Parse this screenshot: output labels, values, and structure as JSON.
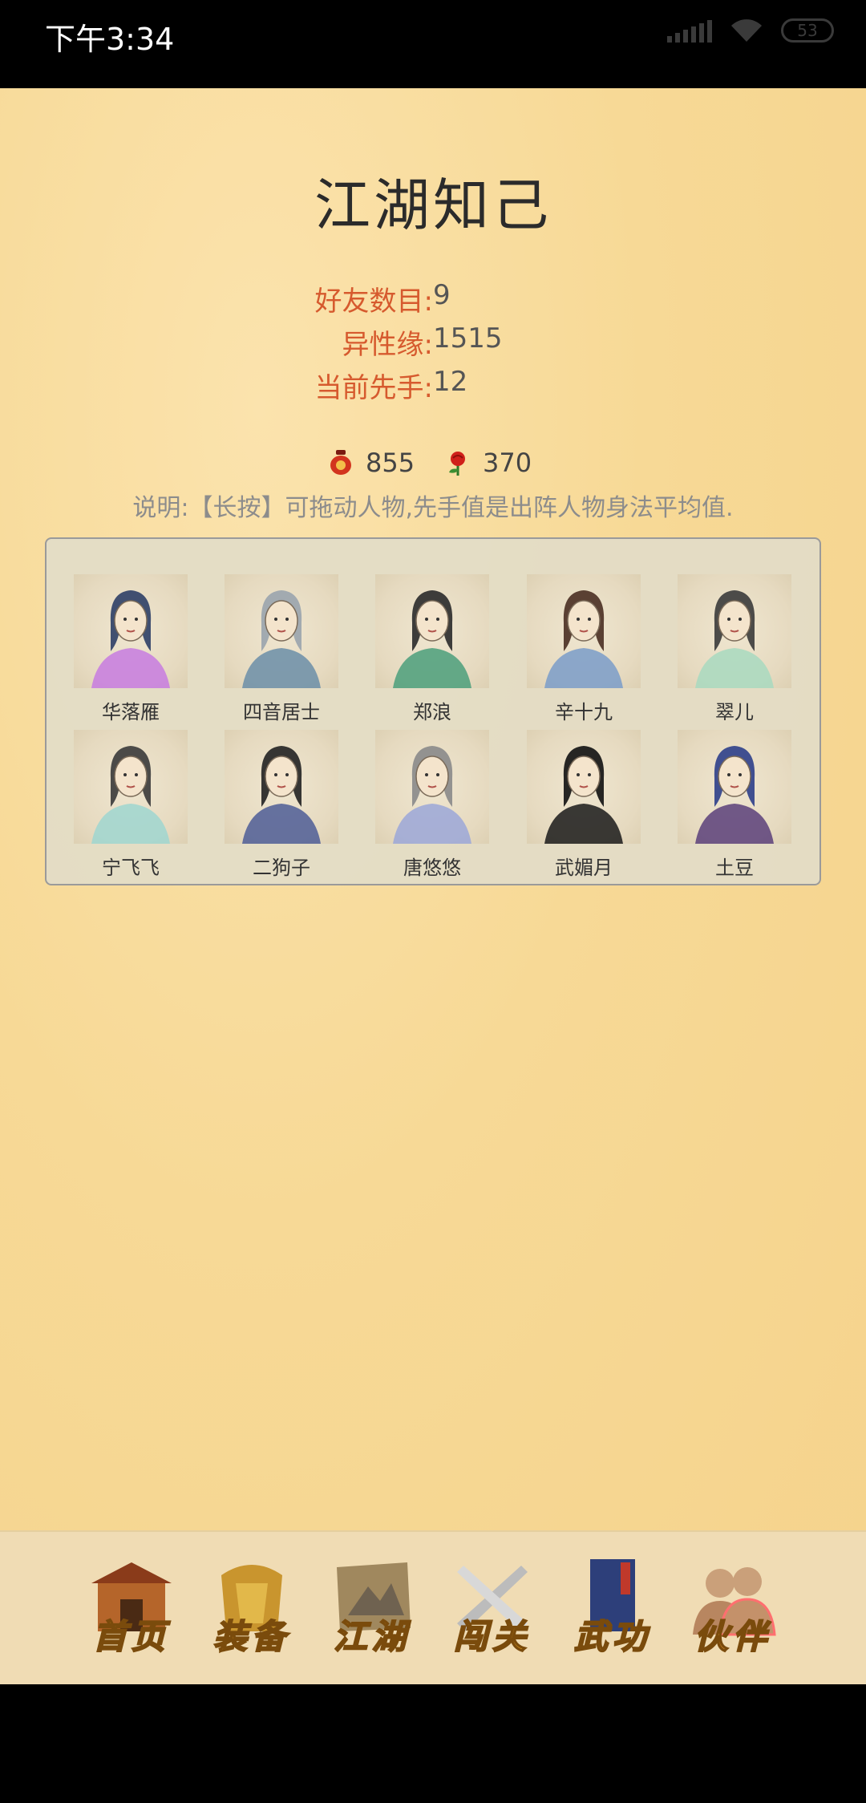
{
  "status_bar": {
    "time": "下午3:34",
    "battery": "53"
  },
  "page": {
    "title": "江湖知己"
  },
  "stats": [
    {
      "label": "好友数目:",
      "value": "9"
    },
    {
      "label": "异性缘:",
      "value": "1515"
    },
    {
      "label": "当前先手:",
      "value": "12"
    }
  ],
  "currency": [
    {
      "icon": "wine-jar-icon",
      "value": "855"
    },
    {
      "icon": "rose-icon",
      "value": "370"
    }
  ],
  "hint": "说明:【长按】可拖动人物,先手值是出阵人物身法平均值.",
  "characters": [
    {
      "name": "华落雁",
      "robe": "#c77be0",
      "hair": "#2e3f66"
    },
    {
      "name": "四音居士",
      "robe": "#6b8ea8",
      "hair": "#9aa4ad"
    },
    {
      "name": "郑浪",
      "robe": "#4b9f7b",
      "hair": "#2a2a2a"
    },
    {
      "name": "辛十九",
      "robe": "#7a9cc9",
      "hair": "#4a2f22"
    },
    {
      "name": "翠儿",
      "robe": "#a8d9bf",
      "hair": "#3b3b3b"
    },
    {
      "name": "宁飞飞",
      "robe": "#9fd6d0",
      "hair": "#3a3a3a"
    },
    {
      "name": "二狗子",
      "robe": "#4d5d96",
      "hair": "#222222"
    },
    {
      "name": "唐悠悠",
      "robe": "#9ba7d8",
      "hair": "#8a8a8a"
    },
    {
      "name": "武媚月",
      "robe": "#1a1a1a",
      "hair": "#111111"
    },
    {
      "name": "土豆",
      "robe": "#5a3f7a",
      "hair": "#2e3f8a"
    }
  ],
  "nav": [
    {
      "label": "首页",
      "name": "nav-home"
    },
    {
      "label": "装备",
      "name": "nav-equipment"
    },
    {
      "label": "江湖",
      "name": "nav-jianghu"
    },
    {
      "label": "闯关",
      "name": "nav-challenge"
    },
    {
      "label": "武功",
      "name": "nav-martial-arts"
    },
    {
      "label": "伙伴",
      "name": "nav-partners",
      "active": true
    }
  ]
}
